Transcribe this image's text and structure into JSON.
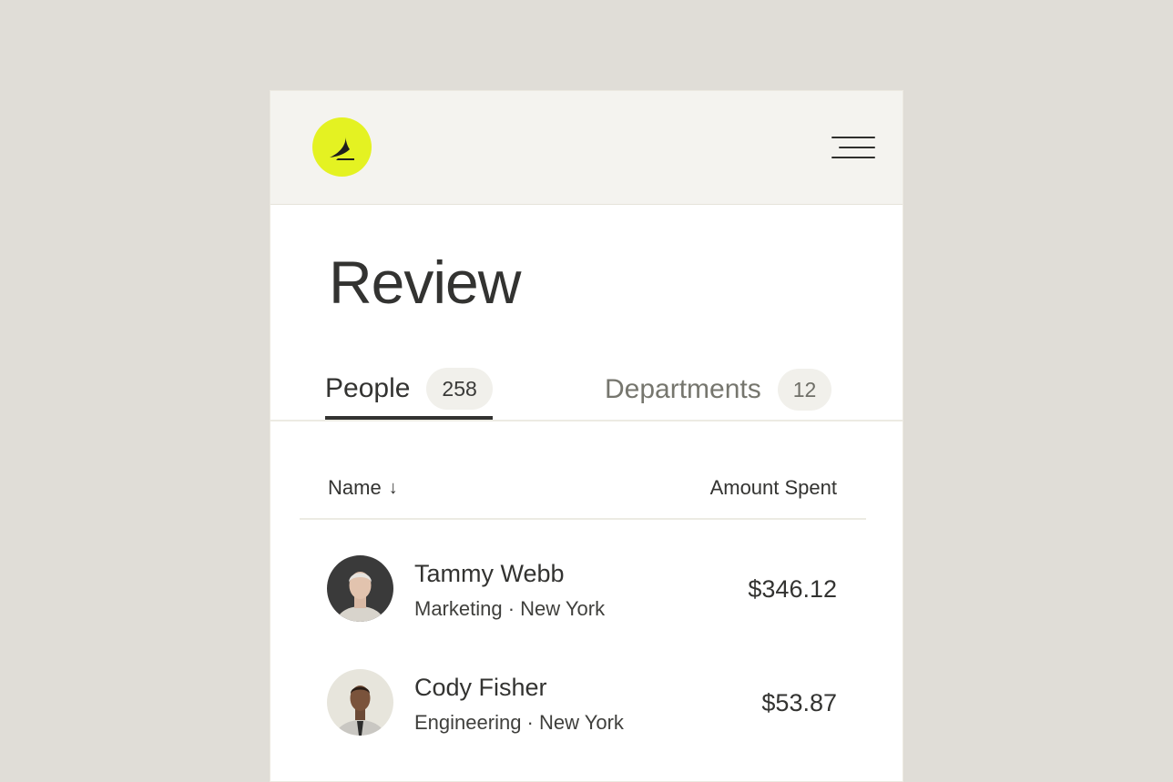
{
  "header": {
    "logo_icon": "brand-swoosh-icon",
    "menu_icon": "hamburger-menu-icon",
    "accent_color": "#e4f222"
  },
  "page": {
    "title": "Review"
  },
  "tabs": [
    {
      "label": "People",
      "count": "258",
      "active": true
    },
    {
      "label": "Departments",
      "count": "12",
      "active": false
    }
  ],
  "table": {
    "columns": {
      "name": "Name",
      "name_sort_icon": "arrow-down-icon",
      "amount": "Amount Spent"
    },
    "rows": [
      {
        "name": "Tammy Webb",
        "meta": "Marketing · New York",
        "amount": "$346.12"
      },
      {
        "name": "Cody Fisher",
        "meta": "Engineering · New York",
        "amount": "$53.87"
      }
    ]
  }
}
